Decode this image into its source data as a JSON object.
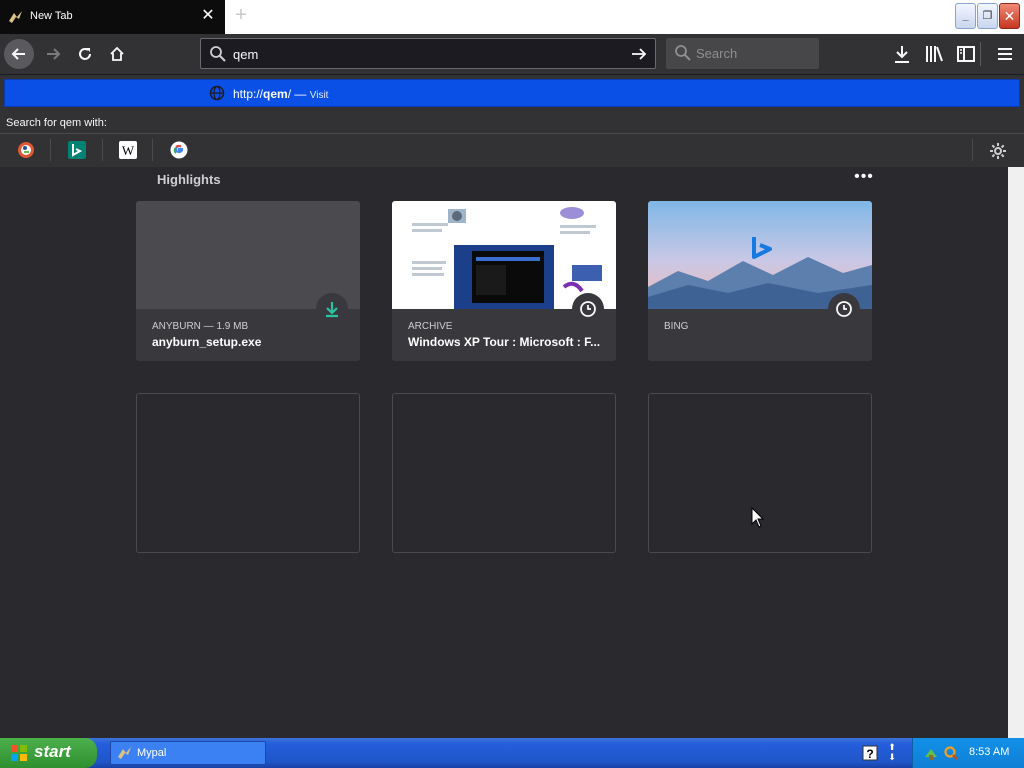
{
  "browser": {
    "tab": {
      "title": "New Tab",
      "close_icon": "close-icon"
    },
    "urlbar": {
      "value": "qem"
    },
    "searchbar": {
      "placeholder": "Search"
    }
  },
  "dropdown": {
    "suggestion": {
      "prefix": "http://",
      "host": "qem",
      "suffix": "/",
      "dash": " — ",
      "action": "Visit"
    },
    "search_with_label": "Search for qem with:",
    "engines": [
      "DuckDuckGo",
      "Bing",
      "Wikipedia",
      "Google"
    ]
  },
  "highlights": {
    "title": "Highlights",
    "more_label": "•••",
    "cards": [
      {
        "context": "ANYBURN — 1.9 MB",
        "title": "anyburn_setup.exe",
        "badge_icon": "download-icon"
      },
      {
        "context": "ARCHIVE",
        "title": "Windows XP Tour : Microsoft : F...",
        "badge_icon": "clock-icon"
      },
      {
        "context": "BING",
        "title": "",
        "badge_icon": "clock-icon"
      }
    ]
  },
  "taskbar": {
    "start_label": "start",
    "task_label": "Mypal",
    "clock": "8:53 AM"
  },
  "colors": {
    "accent": "#0a50e6",
    "download_green": "#2ac3a2",
    "toolbar": "#323234",
    "content": "#2a2a2e"
  }
}
